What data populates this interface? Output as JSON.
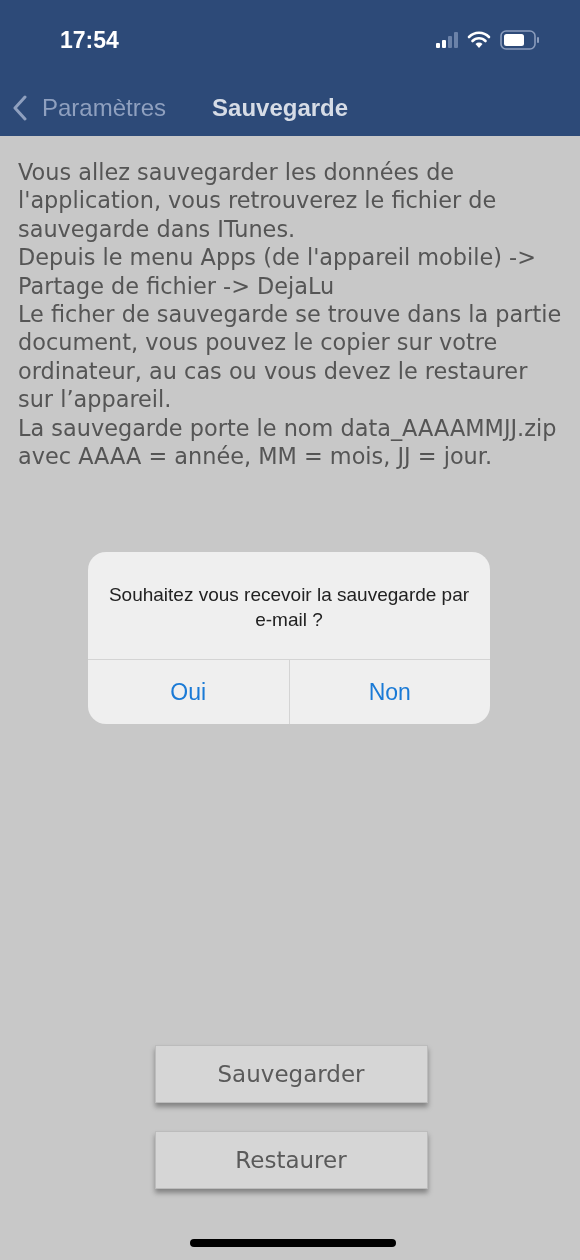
{
  "status_bar": {
    "time": "17:54"
  },
  "nav_bar": {
    "back_label": "Paramètres",
    "title": "Sauvegarde"
  },
  "description": [
    "Vous allez sauvegarder les données de l'application, vous retrouverez le fichier de sauvegarde dans ITunes.",
    "Depuis le menu Apps (de l'appareil mobile) -> Partage de fichier -> DejaLu",
    "Le ficher de sauvegarde se trouve dans la partie document, vous pouvez le copier sur votre ordinateur, au cas ou vous devez le restaurer sur l’appareil.",
    "La sauvegarde porte le nom data_AAAAMMJJ.zip avec AAAA = année, MM = mois, JJ = jour."
  ],
  "buttons": [
    "Sauvegarder",
    "Restaurer"
  ],
  "alert": {
    "message": "Souhaitez vous recevoir la sauvegarde par e-mail ?",
    "actions": [
      "Oui",
      "Non"
    ]
  }
}
